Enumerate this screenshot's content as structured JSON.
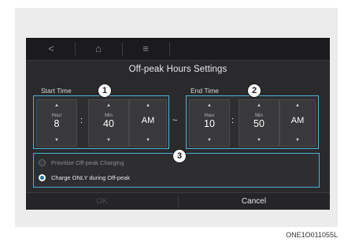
{
  "nav": {
    "back_glyph": "<",
    "home_glyph": "⌂",
    "menu_glyph": "≡"
  },
  "title": "Off-peak Hours Settings",
  "start": {
    "label": "Start Time",
    "hour_unit": "Hour",
    "hour": "8",
    "min_unit": "Min",
    "min": "40",
    "ampm": "AM"
  },
  "end": {
    "label": "End Time",
    "hour_unit": "Hour",
    "hour": "10",
    "min_unit": "Min",
    "min": "50",
    "ampm": "AM"
  },
  "separator": "~",
  "colon": ":",
  "arrow_up": "▲",
  "arrow_down": "▼",
  "options": [
    {
      "label": "Prioritize Off-peak Charging",
      "selected": false
    },
    {
      "label": "Charge ONLY during Off-peak",
      "selected": true
    }
  ],
  "buttons": {
    "ok": "OK",
    "cancel": "Cancel"
  },
  "callouts": [
    "1",
    "2",
    "3"
  ],
  "caption": "ONE1O011055L",
  "colors": {
    "accent": "#4fb0d8",
    "screen_bg": "#2a2a2c",
    "text": "#ffffff"
  }
}
